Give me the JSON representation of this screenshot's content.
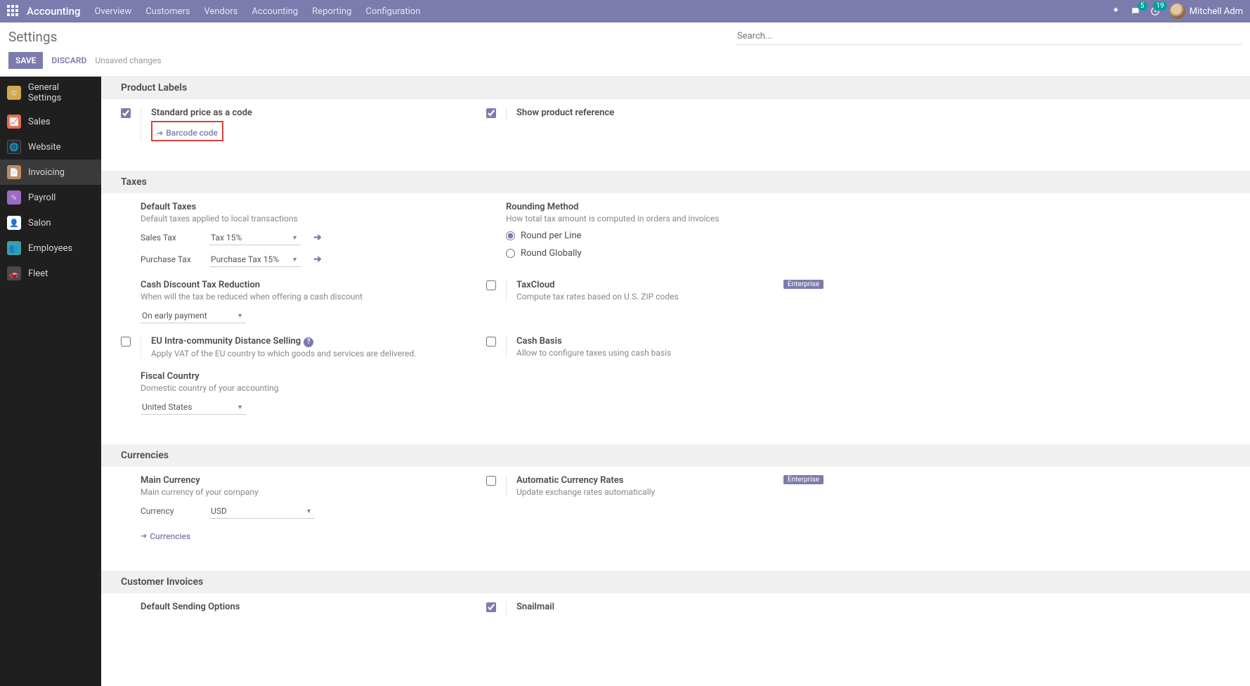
{
  "header": {
    "app_name": "Accounting",
    "menu": [
      "Overview",
      "Customers",
      "Vendors",
      "Accounting",
      "Reporting",
      "Configuration"
    ],
    "badge_msg": "5",
    "badge_activity": "19",
    "user": "Mitchell Adm"
  },
  "page": {
    "title": "Settings",
    "search_placeholder": "Search...",
    "save": "SAVE",
    "discard": "DISCARD",
    "unsaved": "Unsaved changes"
  },
  "sidebar": {
    "items": [
      {
        "label": "General Settings"
      },
      {
        "label": "Sales"
      },
      {
        "label": "Website"
      },
      {
        "label": "Invoicing"
      },
      {
        "label": "Payroll"
      },
      {
        "label": "Salon"
      },
      {
        "label": "Employees"
      },
      {
        "label": "Fleet"
      }
    ]
  },
  "sections": {
    "product_labels": {
      "header": "Product Labels",
      "std_price": "Standard price as a code",
      "barcode_link": "Barcode code",
      "show_ref": "Show product reference"
    },
    "taxes": {
      "header": "Taxes",
      "default_title": "Default Taxes",
      "default_desc": "Default taxes applied to local transactions",
      "sales_tax_label": "Sales Tax",
      "sales_tax_value": "Tax 15%",
      "purchase_tax_label": "Purchase Tax",
      "purchase_tax_value": "Purchase Tax 15%",
      "rounding_title": "Rounding Method",
      "rounding_desc": "How total tax amount is computed in orders and invoices",
      "round_line": "Round per Line",
      "round_global": "Round Globally",
      "cash_discount_title": "Cash Discount Tax Reduction",
      "cash_discount_desc": "When will the tax be reduced when offering a cash discount",
      "cash_discount_value": "On early payment",
      "taxcloud_title": "TaxCloud",
      "taxcloud_desc": "Compute tax rates based on U.S. ZIP codes",
      "eu_title": "EU Intra-community Distance Selling",
      "eu_desc": "Apply VAT of the EU country to which goods and services are delivered.",
      "cash_basis_title": "Cash Basis",
      "cash_basis_desc": "Allow to configure taxes using cash basis",
      "fiscal_title": "Fiscal Country",
      "fiscal_desc": "Domestic country of your accounting",
      "fiscal_value": "United States",
      "enterprise": "Enterprise"
    },
    "currencies": {
      "header": "Currencies",
      "main_title": "Main Currency",
      "main_desc": "Main currency of your company",
      "currency_label": "Currency",
      "currency_value": "USD",
      "currencies_link": "Currencies",
      "auto_title": "Automatic Currency Rates",
      "auto_desc": "Update exchange rates automatically",
      "enterprise": "Enterprise"
    },
    "invoices": {
      "header": "Customer Invoices",
      "default_sending": "Default Sending Options",
      "snailmail": "Snailmail"
    }
  }
}
